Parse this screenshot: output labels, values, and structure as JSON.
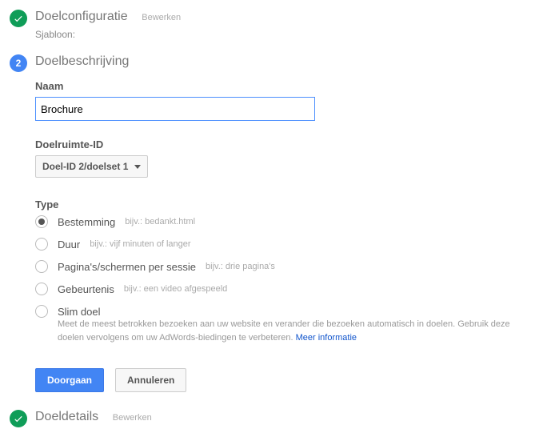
{
  "step1": {
    "title": "Doelconfiguratie",
    "edit": "Bewerken",
    "sub": "Sjabloon:"
  },
  "step2": {
    "number": "2",
    "title": "Doelbeschrijving",
    "name_label": "Naam",
    "name_value": "Brochure",
    "slot_label": "Doelruimte-ID",
    "slot_value": "Doel-ID 2/doelset 1",
    "type_label": "Type",
    "types": [
      {
        "label": "Bestemming",
        "hint": "bijv.: bedankt.html"
      },
      {
        "label": "Duur",
        "hint": "bijv.: vijf minuten of langer"
      },
      {
        "label": "Pagina's/schermen per sessie",
        "hint": "bijv.: drie pagina's"
      },
      {
        "label": "Gebeurtenis",
        "hint": "bijv.: een video afgespeeld"
      },
      {
        "label": "Slim doel",
        "hint": ""
      }
    ],
    "smart_desc": "Meet de meest betrokken bezoeken aan uw website en verander die bezoeken automatisch in doelen. Gebruik deze doelen vervolgens om uw AdWords-biedingen te verbeteren. ",
    "smart_link": "Meer informatie",
    "continue": "Doorgaan",
    "cancel": "Annuleren"
  },
  "step3": {
    "title": "Doeldetails",
    "edit": "Bewerken"
  }
}
